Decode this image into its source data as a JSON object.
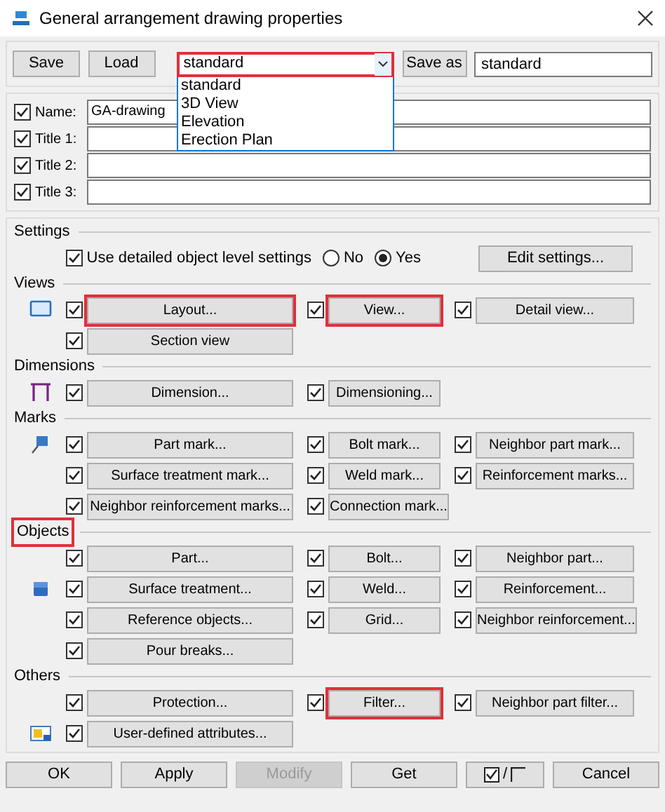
{
  "window": {
    "title": "General arrangement drawing properties"
  },
  "toolbar": {
    "save": "Save",
    "load": "Load",
    "dropdown": {
      "value": "standard",
      "expanded": true,
      "highlighted": true,
      "options": [
        "standard",
        "3D View",
        "Elevation",
        "Erection Plan"
      ]
    },
    "save_as": "Save as",
    "save_as_value": "standard"
  },
  "fields": [
    {
      "label": "Name:",
      "checked": true,
      "value": "GA-drawing"
    },
    {
      "label": "Title 1:",
      "checked": true
    },
    {
      "label": "Title 2:",
      "checked": true
    },
    {
      "label": "Title 3:",
      "checked": true
    }
  ],
  "settings": {
    "heading": "Settings",
    "detailed": {
      "label": "Use detailed object level settings",
      "checked": true
    },
    "radios": [
      {
        "label": "No",
        "selected": false
      },
      {
        "label": "Yes",
        "selected": true
      }
    ],
    "edit_button": "Edit settings..."
  },
  "sections": [
    {
      "heading": "Views",
      "highlighted": false,
      "rows": [
        [
          {
            "label": "Layout...",
            "checked": true,
            "highlighted": true
          },
          {
            "label": "View...",
            "checked": true,
            "highlighted": true
          },
          {
            "label": "Detail view...",
            "checked": true,
            "highlighted": false
          }
        ],
        [
          {
            "label": "Section view",
            "checked": true,
            "highlighted": false
          }
        ]
      ]
    },
    {
      "heading": "Dimensions",
      "highlighted": false,
      "rows": [
        [
          {
            "label": "Dimension...",
            "checked": true,
            "highlighted": false
          },
          {
            "label": "Dimensioning...",
            "checked": true,
            "highlighted": false
          }
        ]
      ]
    },
    {
      "heading": "Marks",
      "highlighted": false,
      "rows": [
        [
          {
            "label": "Part mark...",
            "checked": true,
            "highlighted": false
          },
          {
            "label": "Bolt mark...",
            "checked": true,
            "highlighted": false
          },
          {
            "label": "Neighbor part mark...",
            "checked": true,
            "highlighted": false
          }
        ],
        [
          {
            "label": "Surface treatment mark...",
            "checked": true,
            "highlighted": false
          },
          {
            "label": "Weld mark...",
            "checked": true,
            "highlighted": false
          },
          {
            "label": "Reinforcement marks...",
            "checked": true,
            "highlighted": false
          }
        ],
        [
          {
            "label": "Neighbor reinforcement marks...",
            "checked": true,
            "highlighted": false
          },
          {
            "label": "Connection mark...",
            "checked": true,
            "highlighted": false
          }
        ]
      ]
    },
    {
      "heading": "Objects",
      "highlighted": true,
      "rows": [
        [
          {
            "label": "Part...",
            "checked": true,
            "highlighted": false
          },
          {
            "label": "Bolt...",
            "checked": true,
            "highlighted": false
          },
          {
            "label": "Neighbor part...",
            "checked": true,
            "highlighted": false
          }
        ],
        [
          {
            "label": "Surface treatment...",
            "checked": true,
            "highlighted": false
          },
          {
            "label": "Weld...",
            "checked": true,
            "highlighted": false
          },
          {
            "label": "Reinforcement...",
            "checked": true,
            "highlighted": false
          }
        ],
        [
          {
            "label": "Reference objects...",
            "checked": true,
            "highlighted": false
          },
          {
            "label": "Grid...",
            "checked": true,
            "highlighted": false
          },
          {
            "label": "Neighbor reinforcement...",
            "checked": true,
            "highlighted": false
          }
        ],
        [
          {
            "label": "Pour breaks...",
            "checked": true,
            "highlighted": false
          }
        ]
      ]
    },
    {
      "heading": "Others",
      "highlighted": false,
      "rows": [
        [
          {
            "label": "Protection...",
            "checked": true,
            "highlighted": false
          },
          {
            "label": "Filter...",
            "checked": true,
            "highlighted": true
          },
          {
            "label": "Neighbor part filter...",
            "checked": true,
            "highlighted": false
          }
        ],
        [
          {
            "label": "User-defined attributes...",
            "checked": true,
            "highlighted": false
          }
        ]
      ]
    }
  ],
  "bottom_buttons": [
    {
      "kind": "button",
      "label": "OK",
      "disabled": false
    },
    {
      "kind": "button",
      "label": "Apply",
      "disabled": false
    },
    {
      "kind": "button",
      "label": "Modify",
      "disabled": true
    },
    {
      "kind": "button",
      "label": "Get",
      "disabled": false
    },
    {
      "kind": "toggle",
      "label": "/",
      "disabled": false
    },
    {
      "kind": "button",
      "label": "Cancel",
      "disabled": false
    }
  ]
}
